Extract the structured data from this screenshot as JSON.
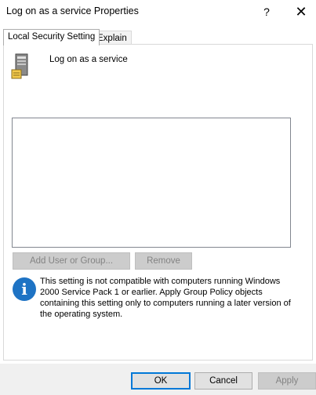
{
  "window": {
    "title": "Log on as a service Properties",
    "help_glyph": "?",
    "close_glyph": "✕"
  },
  "tabs": [
    {
      "label": "Local Security Setting",
      "active": true
    },
    {
      "label": "Explain",
      "active": false
    }
  ],
  "policy": {
    "icon": "server-icon",
    "name": "Log on as a service"
  },
  "accounts_list": [],
  "buttons": {
    "add_user": "Add User or Group...",
    "remove": "Remove"
  },
  "info": {
    "icon": "info-icon",
    "glyph": "i",
    "text": "This setting is not compatible with computers running Windows 2000 Service Pack 1 or earlier.  Apply Group Policy objects containing this setting only to computers running a later version of the operating system."
  },
  "footer": {
    "ok": "OK",
    "cancel": "Cancel",
    "apply": "Apply"
  },
  "colors": {
    "accent": "#0078d7",
    "info_blue": "#1e73c4",
    "disabled_text": "#838383"
  }
}
